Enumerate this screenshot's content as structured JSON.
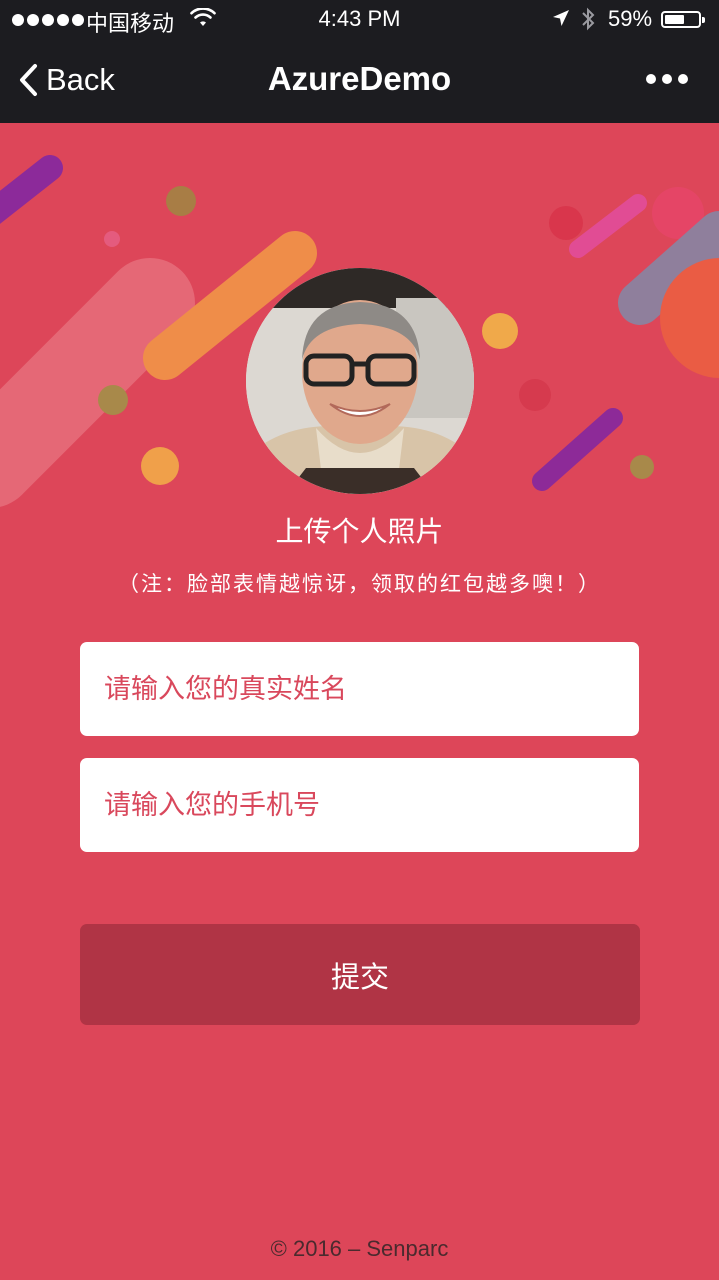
{
  "status_bar": {
    "carrier": "中国移动",
    "time": "4:43 PM",
    "battery_percent": "59%",
    "battery_level": 0.59,
    "signal_dots": 5,
    "icons": [
      "wifi-icon",
      "location-arrow-icon",
      "bluetooth-icon",
      "battery-icon"
    ]
  },
  "nav": {
    "back_label": "Back",
    "title": "AzureDemo",
    "more_icon": "ellipsis-icon"
  },
  "upload": {
    "title": "上传个人照片",
    "note": "（注：脸部表情越惊讶，领取的红包越多噢！）"
  },
  "form": {
    "name_placeholder": "请输入您的真实姓名",
    "name_value": "",
    "phone_placeholder": "请输入您的手机号",
    "phone_value": "",
    "submit_label": "提交"
  },
  "footer": {
    "text": "© 2016 – Senparc"
  },
  "colors": {
    "background": "#dd4659",
    "topbar": "#1c1c20",
    "button": "#b03445",
    "placeholder": "#d9485c"
  }
}
